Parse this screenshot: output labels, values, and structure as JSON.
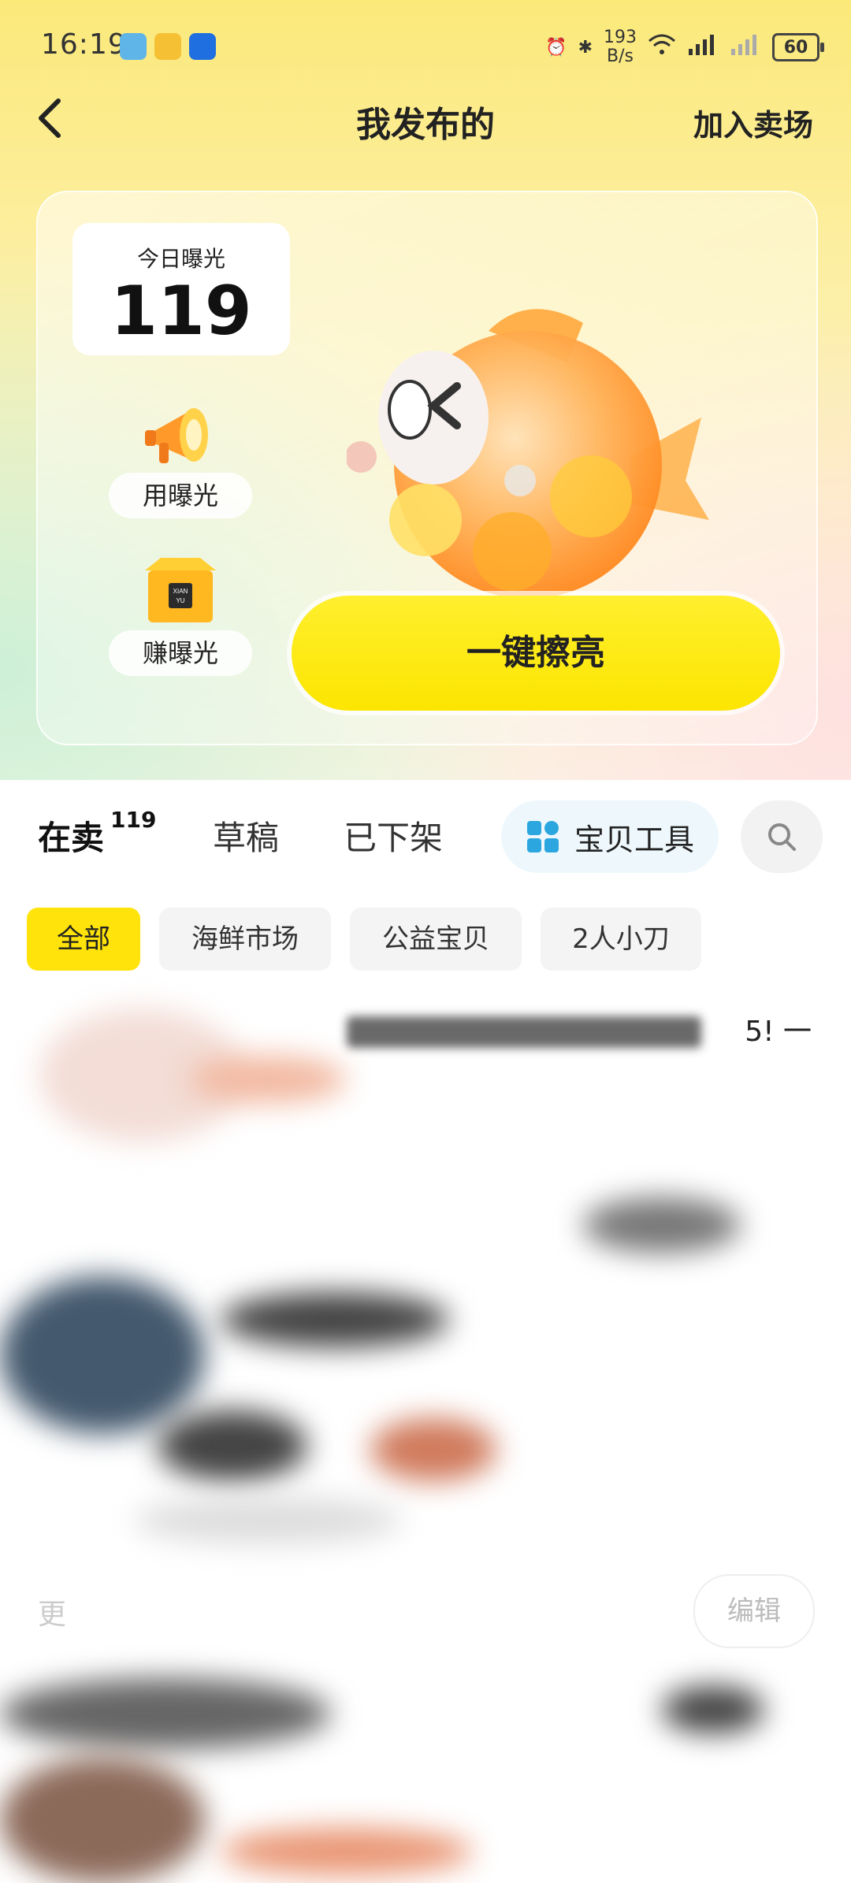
{
  "status_bar": {
    "time": "16:19",
    "speed_value": "193",
    "speed_unit": "B/s",
    "battery": "60"
  },
  "nav": {
    "title": "我发布的",
    "right_action": "加入卖场"
  },
  "hero": {
    "exposure_label": "今日曝光",
    "exposure_value": "119",
    "use_exposure": "用曝光",
    "earn_exposure": "赚曝光",
    "shine_button": "一键擦亮",
    "box_text": "XIAN YU"
  },
  "tabs": [
    {
      "label": "在卖",
      "count": "119"
    },
    {
      "label": "草稿"
    },
    {
      "label": "已下架"
    }
  ],
  "tools_button": "宝贝工具",
  "filters": [
    "全部",
    "海鲜市场",
    "公益宝贝",
    "2人小刀"
  ],
  "listing": {
    "title_tail": "5! 一",
    "edit_label": "编辑"
  },
  "colors": {
    "accent": "#FFE30A",
    "tools_bg": "#EEF8FC",
    "tools_icon": "#2BA6DE"
  }
}
